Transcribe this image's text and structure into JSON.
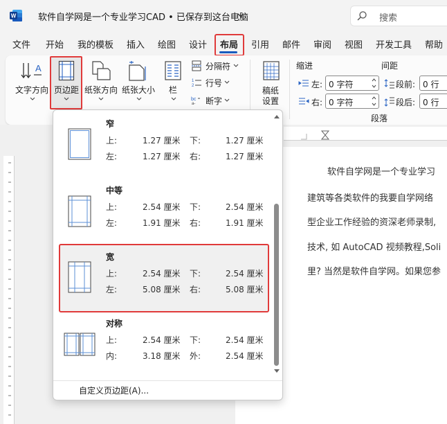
{
  "titlebar": {
    "title": "软件自学网是一个专业学习CAD • 已保存到这台电脑",
    "search_placeholder": "搜索"
  },
  "tabs": [
    {
      "label": "文件"
    },
    {
      "label": "开始"
    },
    {
      "label": "我的模板"
    },
    {
      "label": "插入"
    },
    {
      "label": "绘图"
    },
    {
      "label": "设计"
    },
    {
      "label": "布局",
      "active": true
    },
    {
      "label": "引用"
    },
    {
      "label": "邮件"
    },
    {
      "label": "审阅"
    },
    {
      "label": "视图"
    },
    {
      "label": "开发工具"
    },
    {
      "label": "帮助"
    }
  ],
  "ribbon": {
    "text_direction": "文字方向",
    "margins": "页边距",
    "orientation": "纸张方向",
    "size": "纸张大小",
    "columns": "栏",
    "breaks": "分隔符",
    "line_numbers": "行号",
    "hyphenation": "断字",
    "manuscript_line1": "稿纸",
    "manuscript_line2": "设置",
    "indent_header": "缩进",
    "spacing_header": "间距",
    "indent_left_label": "左:",
    "indent_left_value": "0 字符",
    "indent_right_label": "右:",
    "indent_right_value": "0 字符",
    "spacing_before_label": "段前:",
    "spacing_before_value": "0 行",
    "spacing_after_label": "段后:",
    "spacing_after_value": "0 行",
    "paragraph_group": "段落"
  },
  "margin_options": [
    {
      "name": "窄",
      "l1": "上:",
      "v1": "1.27 厘米",
      "l2": "下:",
      "v2": "1.27 厘米",
      "l3": "左:",
      "v3": "1.27 厘米",
      "l4": "右:",
      "v4": "1.27 厘米"
    },
    {
      "name": "中等",
      "l1": "上:",
      "v1": "2.54 厘米",
      "l2": "下:",
      "v2": "2.54 厘米",
      "l3": "左:",
      "v3": "1.91 厘米",
      "l4": "右:",
      "v4": "1.91 厘米"
    },
    {
      "name": "宽",
      "l1": "上:",
      "v1": "2.54 厘米",
      "l2": "下:",
      "v2": "2.54 厘米",
      "l3": "左:",
      "v3": "5.08 厘米",
      "l4": "右:",
      "v4": "5.08 厘米",
      "selected": true
    },
    {
      "name": "对称",
      "l1": "上:",
      "v1": "2.54 厘米",
      "l2": "下:",
      "v2": "2.54 厘米",
      "l3": "内:",
      "v3": "3.18 厘米",
      "l4": "外:",
      "v4": "2.54 厘米"
    }
  ],
  "custom_margins": "自定义页边距(A)...",
  "document": {
    "lines": [
      "软件自学网是一个专业学习",
      "建筑等各类软件的我要自学网络",
      "型企业工作经验的资深老师录制,",
      "技术, 如 AutoCAD 视频教程,Soli",
      "里? 当然是软件自学网。如果您参"
    ]
  },
  "colors": {
    "accent": "#185abd",
    "highlight": "#e03a3a",
    "word_blue": "#185abd"
  }
}
